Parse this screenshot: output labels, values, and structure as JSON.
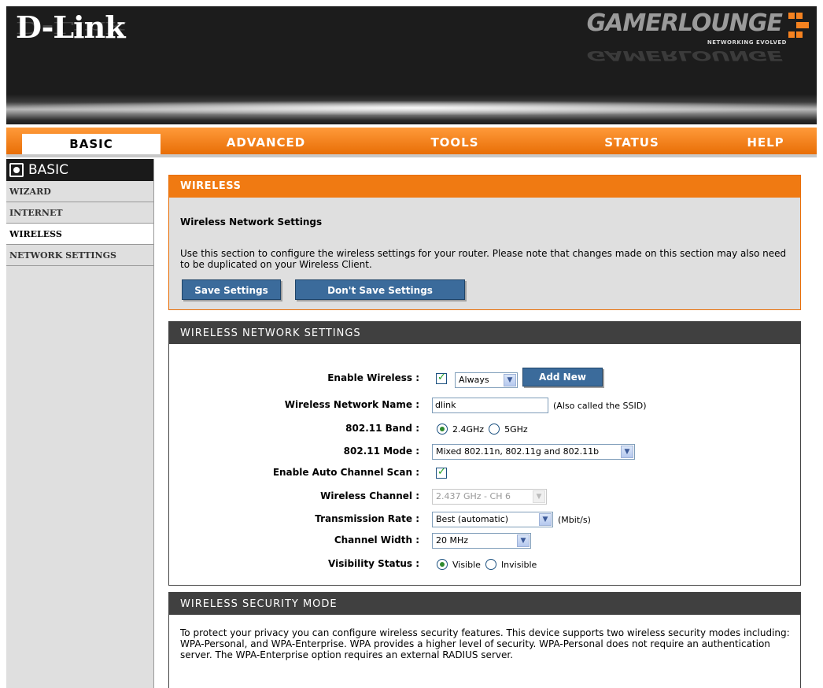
{
  "header": {
    "logo": "D-Link",
    "brand": "GAMERLOUNGE",
    "brand_tagline": "NETWORKING EVOLVED"
  },
  "nav": {
    "tabs": [
      "BASIC",
      "ADVANCED",
      "TOOLS",
      "STATUS",
      "HELP"
    ],
    "active": "BASIC"
  },
  "sidebar": {
    "title": "BASIC",
    "items": [
      "WIZARD",
      "INTERNET",
      "WIRELESS",
      "NETWORK SETTINGS"
    ],
    "active": "WIRELESS"
  },
  "wireless_panel": {
    "title": "WIRELESS",
    "subtitle": "Wireless Network Settings",
    "description": "Use this section to configure the wireless settings for your router. Please note that changes made on this section may also need to be duplicated on your Wireless Client.",
    "save_label": "Save Settings",
    "dont_save_label": "Don't Save Settings"
  },
  "settings_panel": {
    "title": "WIRELESS NETWORK SETTINGS",
    "enable_wireless": {
      "label": "Enable Wireless :",
      "checked": true,
      "schedule": "Always",
      "add_new": "Add New"
    },
    "network_name": {
      "label": "Wireless Network Name :",
      "value": "dlink",
      "note": "(Also called the SSID)"
    },
    "band": {
      "label": "802.11 Band :",
      "options": [
        "2.4GHz",
        "5GHz"
      ],
      "selected": "2.4GHz"
    },
    "mode": {
      "label": "802.11 Mode :",
      "value": "Mixed 802.11n, 802.11g and 802.11b"
    },
    "auto_channel": {
      "label": "Enable Auto Channel Scan :",
      "checked": true
    },
    "channel": {
      "label": "Wireless Channel :",
      "value": "2.437 GHz - CH 6"
    },
    "tx_rate": {
      "label": "Transmission Rate :",
      "value": "Best (automatic)",
      "unit": "(Mbit/s)"
    },
    "channel_width": {
      "label": "Channel Width :",
      "value": "20 MHz"
    },
    "visibility": {
      "label": "Visibility Status :",
      "options": [
        "Visible",
        "Invisible"
      ],
      "selected": "Visible"
    }
  },
  "security_panel": {
    "title": "WIRELESS SECURITY MODE",
    "description": "To protect your privacy you can configure wireless security features. This device supports two wireless security modes including: WPA-Personal, and WPA-Enterprise. WPA provides a higher level of security. WPA-Personal does not require an authentication server. The WPA-Enterprise option requires an external RADIUS server."
  },
  "colors": {
    "accent": "#f07a12",
    "button": "#3b6b9b",
    "dark_header": "#404040"
  }
}
